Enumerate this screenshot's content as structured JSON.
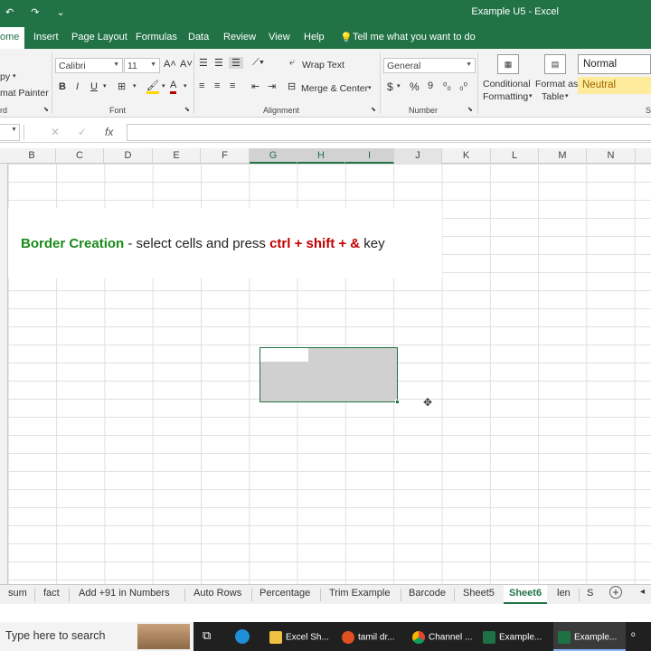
{
  "titlebar": {
    "qat": "↶ ↷ ⌄",
    "title": "Example U5  -  Excel"
  },
  "menu": {
    "tabs": [
      "ome",
      "Insert",
      "Page Layout",
      "Formulas",
      "Data",
      "Review",
      "View",
      "Help"
    ],
    "tell_me": "Tell me what you want to do"
  },
  "ribbon": {
    "clipboard": {
      "copy": "py",
      "format_painter": "mat Painter",
      "label": "rd"
    },
    "font": {
      "name": "Calibri",
      "size": "11",
      "label": "Font",
      "bold": "B",
      "italic": "I",
      "underline": "U"
    },
    "alignment": {
      "wrap_text": "Wrap Text",
      "merge_center": "Merge & Center",
      "label": "Alignment"
    },
    "number": {
      "format": "General",
      "label": "Number",
      "currency": "$",
      "percent": "%",
      "comma": "9"
    },
    "styles": {
      "conditional": [
        "Conditional",
        "Formatting"
      ],
      "format_table": [
        "Format as",
        "Table"
      ],
      "normal": "Normal",
      "neutral": "Neutral",
      "label": "S"
    }
  },
  "formula_bar": {
    "fx": "fx",
    "cancel": "✕",
    "enter": "✓",
    "value": ""
  },
  "columns": [
    "B",
    "C",
    "D",
    "E",
    "F",
    "G",
    "H",
    "I",
    "J",
    "K",
    "L",
    "M",
    "N"
  ],
  "banner": {
    "part1": "Border Creation",
    "part2": " - select cells and press ",
    "part3": "ctrl + shift + &",
    "part4": " key"
  },
  "sheet_tabs": [
    "sum",
    "fact",
    "Add +91 in Numbers",
    "Auto Rows",
    "Percentage",
    "Trim Example",
    "Barcode",
    "Sheet5",
    "Sheet6",
    "len",
    "S"
  ],
  "active_sheet": "Sheet6",
  "taskbar": {
    "search_placeholder": "Type here to search",
    "items": [
      "Excel Sh...",
      "tamil dr...",
      "Channel ...",
      "Example...",
      "Example..."
    ]
  }
}
